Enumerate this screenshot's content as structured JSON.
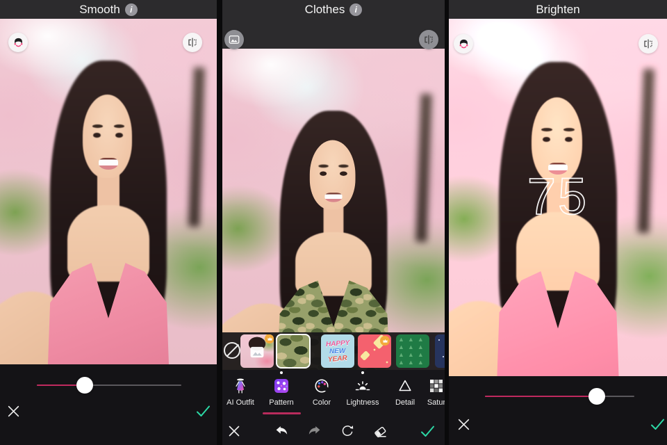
{
  "app": {
    "accent_pink": "#c02a5f",
    "accent_teal": "#2cd9a6",
    "info_glyph": "i"
  },
  "panels": [
    {
      "id": "smooth",
      "title": "Smooth",
      "has_info": true,
      "top_buttons": [
        {
          "icon": "face-shapes-icon"
        },
        {
          "icon": "compare-split-icon"
        }
      ],
      "slider": {
        "value": 33
      },
      "footer": {
        "cancel_icon": "close-icon",
        "confirm_icon": "check-icon"
      }
    },
    {
      "id": "clothes",
      "title": "Clothes",
      "has_info": true,
      "top_buttons": [
        {
          "icon": "gallery-icon"
        },
        {
          "icon": "compare-split-icon"
        }
      ],
      "thumbnails": [
        {
          "name": "none"
        },
        {
          "name": "custom-photo",
          "premium": true
        },
        {
          "name": "camouflage",
          "selected": true
        },
        {
          "name": "happy-new-year",
          "lines": [
            "HAPPY",
            "NEW",
            "YEAR"
          ]
        },
        {
          "name": "red-sparkles",
          "premium": true
        },
        {
          "name": "green-trees",
          "tree_glyphs": "▲▲▲▲▲▲▲▲▲▲▲▲▲▲▲▲"
        },
        {
          "name": "navy-stars"
        }
      ],
      "tabs": [
        {
          "label": "AI Outfit",
          "selected": false,
          "dot": false
        },
        {
          "label": "Pattern",
          "selected": true,
          "dot": true
        },
        {
          "label": "Color",
          "selected": false,
          "dot": false
        },
        {
          "label": "Lightness",
          "selected": false,
          "dot": true
        },
        {
          "label": "Detail",
          "selected": false,
          "dot": false
        },
        {
          "label": "Satur",
          "selected": false,
          "dot": false
        }
      ],
      "toolbar": [
        "close",
        "undo",
        "redo",
        "reset",
        "eraser",
        "confirm"
      ]
    },
    {
      "id": "brighten",
      "title": "Brighten",
      "has_info": false,
      "top_buttons": [
        {
          "icon": "face-shapes-icon"
        },
        {
          "icon": "compare-split-icon"
        }
      ],
      "overlay_value": "75",
      "slider": {
        "value": 75
      },
      "footer": {
        "cancel_icon": "close-icon",
        "confirm_icon": "check-icon"
      }
    }
  ]
}
